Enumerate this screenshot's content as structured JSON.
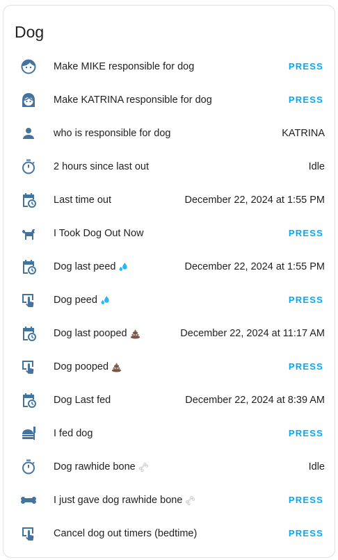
{
  "card": {
    "title": "Dog"
  },
  "rows": [
    {
      "icon": "face-man-icon",
      "label": "Make MIKE responsible for dog",
      "emoji": "",
      "kind": "button",
      "value": "PRESS"
    },
    {
      "icon": "face-woman-icon",
      "label": "Make KATRINA responsible for dog",
      "emoji": "",
      "kind": "button",
      "value": "PRESS"
    },
    {
      "icon": "account-icon",
      "label": "who is responsible for dog",
      "emoji": "",
      "kind": "state",
      "value": "KATRINA"
    },
    {
      "icon": "timer-icon",
      "label": "2 hours since last out",
      "emoji": "",
      "kind": "state",
      "value": "Idle"
    },
    {
      "icon": "calendar-clock-icon",
      "label": "Last time out",
      "emoji": "",
      "kind": "state",
      "value": "December 22, 2024 at 1:55 PM"
    },
    {
      "icon": "dog-icon",
      "label": "I Took Dog Out Now",
      "emoji": "",
      "kind": "button",
      "value": "PRESS"
    },
    {
      "icon": "calendar-clock-icon",
      "label": "Dog last peed",
      "emoji": "droplets-emoji",
      "kind": "state",
      "value": "December 22, 2024 at 1:55 PM"
    },
    {
      "icon": "gesture-tap-button-icon",
      "label": "Dog peed",
      "emoji": "droplets-emoji",
      "kind": "button",
      "value": "PRESS"
    },
    {
      "icon": "calendar-clock-icon",
      "label": "Dog last pooped",
      "emoji": "poop-emoji",
      "kind": "state",
      "value": "December 22, 2024 at 11:17 AM"
    },
    {
      "icon": "gesture-tap-button-icon",
      "label": "Dog pooped",
      "emoji": "poop-emoji",
      "kind": "button",
      "value": "PRESS"
    },
    {
      "icon": "calendar-clock-icon",
      "label": "Dog Last fed",
      "emoji": "",
      "kind": "state",
      "value": "December 22, 2024 at 8:39 AM"
    },
    {
      "icon": "food-icon",
      "label": "I fed dog",
      "emoji": "",
      "kind": "button",
      "value": "PRESS"
    },
    {
      "icon": "timer-icon",
      "label": "Dog rawhide bone",
      "emoji": "bone-emoji",
      "kind": "state",
      "value": "Idle"
    },
    {
      "icon": "bone-icon",
      "label": "I just gave dog rawhide bone",
      "emoji": "bone-emoji",
      "kind": "button",
      "value": "PRESS"
    },
    {
      "icon": "gesture-tap-button-icon",
      "label": "Cancel dog out timers (bedtime)",
      "emoji": "",
      "kind": "button",
      "value": "PRESS"
    }
  ],
  "colors": {
    "icon": "#44739e",
    "accent": "#03a9f4",
    "text": "#212121"
  }
}
